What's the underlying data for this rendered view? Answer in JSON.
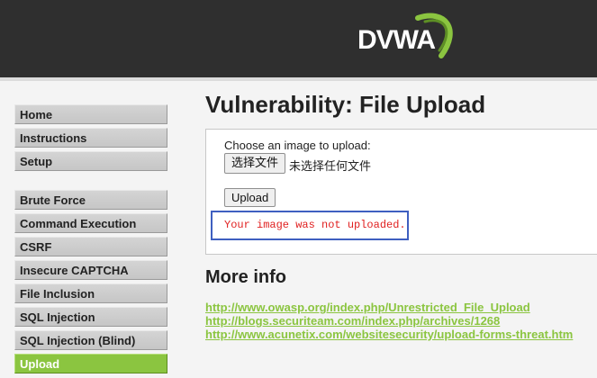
{
  "header": {
    "logo_text": "DVWA",
    "colors": {
      "background": "#2f2f2f",
      "logo_text": "#ffffff",
      "logo_swoosh": "#8bc540"
    }
  },
  "sidebar": {
    "group_1": [
      {
        "label": "Home"
      },
      {
        "label": "Instructions"
      },
      {
        "label": "Setup"
      }
    ],
    "group_2": [
      {
        "label": "Brute Force"
      },
      {
        "label": "Command Execution"
      },
      {
        "label": "CSRF"
      },
      {
        "label": "Insecure CAPTCHA"
      },
      {
        "label": "File Inclusion"
      },
      {
        "label": "SQL Injection"
      },
      {
        "label": "SQL Injection (Blind)"
      },
      {
        "label": "Upload",
        "selected": true
      }
    ],
    "colors": {
      "item": "#c8c8c8",
      "selected": "#8bc540"
    }
  },
  "main": {
    "title": "Vulnerability: File Upload",
    "form": {
      "prompt": "Choose an image to upload:",
      "file_button_label": "选择文件",
      "file_status": "未选择任何文件",
      "upload_button_label": "Upload",
      "error_message": "Your image was not uploaded."
    },
    "more_info": {
      "title": "More info",
      "links": [
        "http://www.owasp.org/index.php/Unrestricted_File_Upload",
        "http://blogs.securiteam.com/index.php/archives/1268",
        "http://www.acunetix.com/websitesecurity/upload-forms-threat.htm"
      ]
    },
    "colors": {
      "error": "#e02020",
      "link": "#8bc540",
      "highlight_box": "#3f5fc0"
    }
  }
}
